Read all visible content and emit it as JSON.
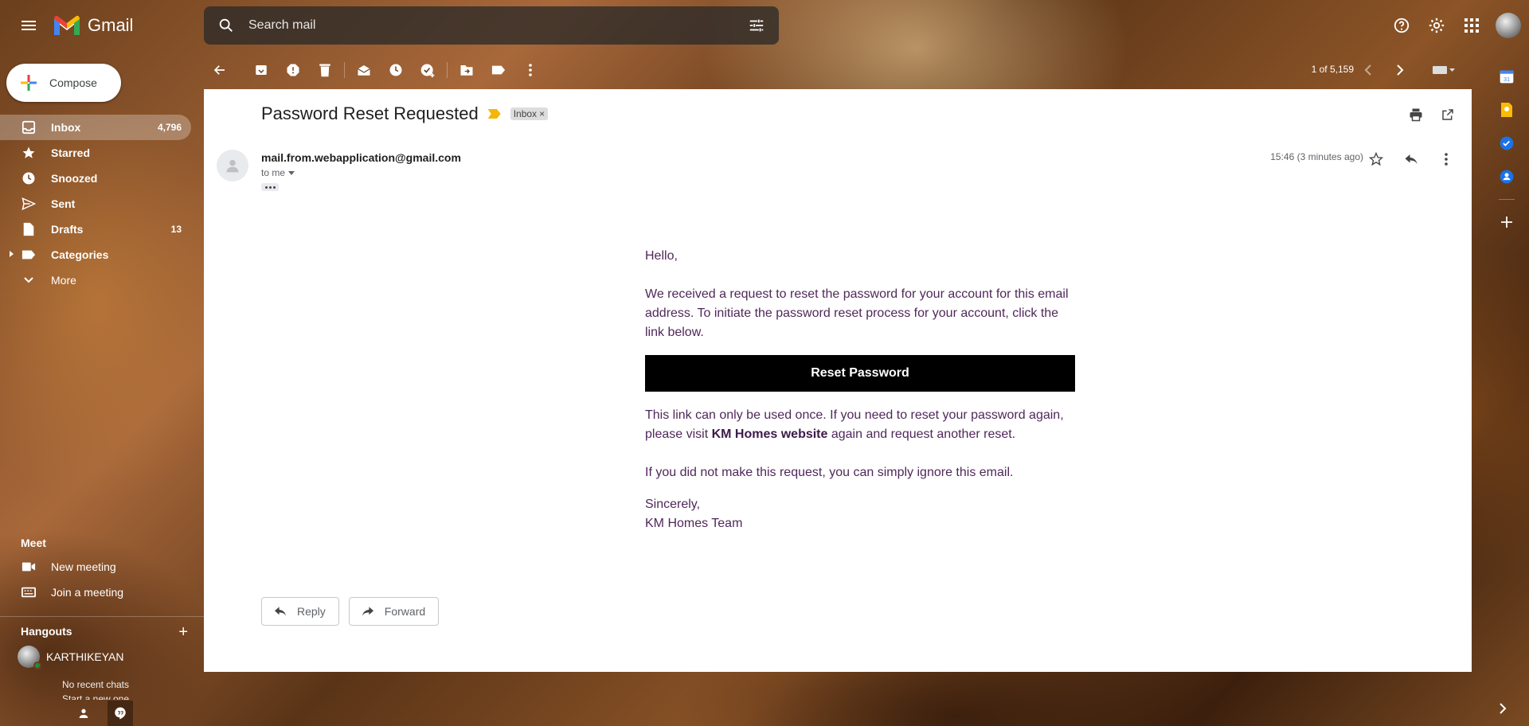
{
  "app": {
    "name": "Gmail"
  },
  "search": {
    "placeholder": "Search mail"
  },
  "compose": {
    "label": "Compose"
  },
  "nav": [
    {
      "id": "inbox",
      "label": "Inbox",
      "count": "4,796",
      "icon": "inbox-icon",
      "active": true
    },
    {
      "id": "starred",
      "label": "Starred",
      "count": "",
      "icon": "star-icon"
    },
    {
      "id": "snoozed",
      "label": "Snoozed",
      "count": "",
      "icon": "clock-icon"
    },
    {
      "id": "sent",
      "label": "Sent",
      "count": "",
      "icon": "send-icon"
    },
    {
      "id": "drafts",
      "label": "Drafts",
      "count": "13",
      "icon": "draft-icon"
    },
    {
      "id": "categories",
      "label": "Categories",
      "count": "",
      "icon": "label-icon"
    },
    {
      "id": "more",
      "label": "More",
      "count": "",
      "icon": "chevron-down-icon"
    }
  ],
  "meet": {
    "title": "Meet",
    "new_meeting": "New meeting",
    "join_meeting": "Join a meeting"
  },
  "hangouts": {
    "title": "Hangouts",
    "user": "KARTHIKEYAN",
    "no_chats": "No recent chats",
    "start_new": "Start a new one"
  },
  "toolbar": {
    "pager": "1 of 5,159"
  },
  "message": {
    "subject": "Password Reset Requested",
    "label": "Inbox",
    "from": "mail.from.webapplication@gmail.com",
    "to": "to me",
    "date": "15:46 (3 minutes ago)",
    "body": {
      "greeting": "Hello,",
      "para1": "We received a request to reset the password for your account for this email address. To initiate the password reset process for your account, click the link below.",
      "button": "Reset Password",
      "para2_a": "This link can only be used once. If you need to reset your password again, please visit ",
      "para2_link": "KM Homes website",
      "para2_b": " again and request another reset.",
      "para3": "If you did not make this request, you can simply ignore this email.",
      "closing": "Sincerely,",
      "signature": "KM Homes Team"
    },
    "reply": "Reply",
    "forward": "Forward"
  },
  "colors": {
    "body_text": "#50285a",
    "important": "#f2b707",
    "inbox_active_bg": "rgba(255,255,255,0.28)"
  }
}
